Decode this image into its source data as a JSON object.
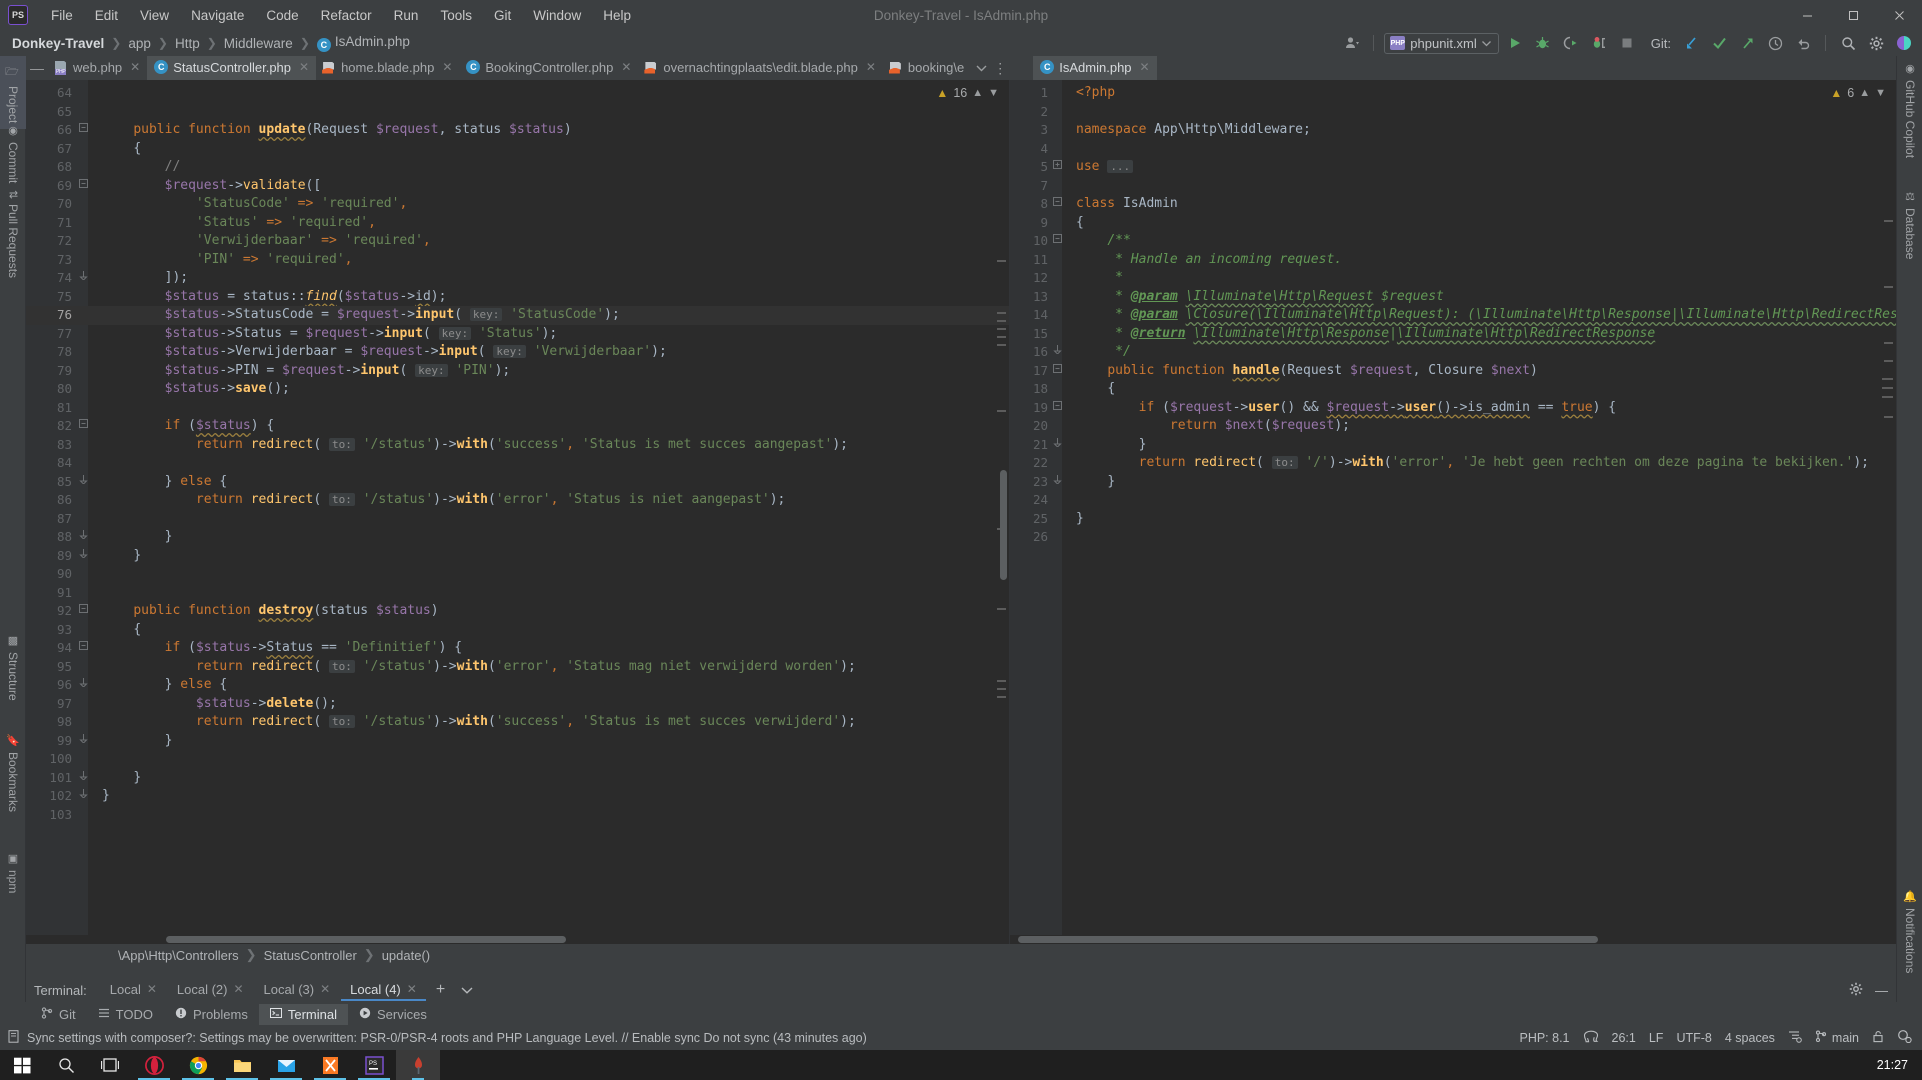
{
  "window": {
    "title": "Donkey-Travel - IsAdmin.php",
    "logo": "PS",
    "controls": [
      "minimize",
      "maximize",
      "close"
    ]
  },
  "menu": {
    "items": [
      "File",
      "Edit",
      "View",
      "Navigate",
      "Code",
      "Refactor",
      "Run",
      "Tools",
      "Git",
      "Window",
      "Help"
    ]
  },
  "breadcrumb": {
    "items": [
      "Donkey-Travel",
      "app",
      "Http",
      "Middleware",
      "IsAdmin.php"
    ],
    "file_icon_letter": "C"
  },
  "toolbar": {
    "run_config": "phpunit.xml",
    "git_label": "Git:",
    "icons": [
      "person-icon",
      "run-icon",
      "debug-icon",
      "coverage-icon",
      "profile-icon",
      "stop-icon",
      "update-project-icon",
      "commit-icon",
      "push-icon",
      "history-icon",
      "rollback-icon",
      "search-everywhere-icon",
      "settings-icon",
      "ai-assistant-icon"
    ]
  },
  "left_stripe": {
    "items": [
      "Project",
      "Commit",
      "Pull Requests",
      "Structure",
      "Bookmarks",
      "npm"
    ],
    "selected": "Project"
  },
  "right_stripe": {
    "items": [
      "GitHub Copilot",
      "Database",
      "Notifications"
    ]
  },
  "tabs": {
    "left_group": [
      {
        "label": "web.php",
        "icon": "php-file-icon",
        "active": false
      },
      {
        "label": "StatusController.php",
        "icon": "php-class-icon",
        "active": true
      },
      {
        "label": "home.blade.php",
        "icon": "blade-file-icon",
        "active": false
      },
      {
        "label": "BookingController.php",
        "icon": "php-class-icon",
        "active": false
      },
      {
        "label": "overnachtingplaats\\edit.blade.php",
        "icon": "blade-file-icon",
        "active": false
      },
      {
        "label": "booking\\e",
        "icon": "blade-file-icon",
        "active": false
      }
    ],
    "right_group": [
      {
        "label": "IsAdmin.php",
        "icon": "php-class-icon",
        "active": true
      }
    ]
  },
  "left_editor": {
    "inspection_count": "16",
    "inspection_icon": "warning-triangle-icon",
    "first_line": 64,
    "current_line": 76,
    "lines": [
      {
        "n": 64,
        "fold": "",
        "html": ""
      },
      {
        "n": 65,
        "fold": "",
        "html": ""
      },
      {
        "n": 66,
        "fold": "minus",
        "html": "    <span class=\"k\">public function</span> <span class=\"fnb sqy\">update</span><span class=\"pl\">(</span><span class=\"cls\">Request</span> <span class=\"var\">$request</span><span class=\"pl\">,</span> <span class=\"cls\">status</span> <span class=\"var\">$status</span><span class=\"pl\">)</span>"
      },
      {
        "n": 67,
        "fold": "",
        "html": "    <span class=\"pl\">{</span>"
      },
      {
        "n": 68,
        "fold": "",
        "html": "        <span class=\"cmt\">//</span>"
      },
      {
        "n": 69,
        "fold": "minus",
        "html": "        <span class=\"var\">$request</span><span class=\"pl\">-&gt;</span><span class=\"fn\">validate</span><span class=\"pl\">([</span>"
      },
      {
        "n": 70,
        "fold": "",
        "html": "            <span class=\"str\">'StatusCode'</span> <span class=\"k\">=&gt;</span> <span class=\"str\">'required'</span><span class=\"k\">,</span>"
      },
      {
        "n": 71,
        "fold": "",
        "html": "            <span class=\"str\">'Status'</span> <span class=\"k\">=&gt;</span> <span class=\"str\">'required'</span><span class=\"k\">,</span>"
      },
      {
        "n": 72,
        "fold": "",
        "html": "            <span class=\"str\">'Verwijderbaar'</span> <span class=\"k\">=&gt;</span> <span class=\"str\">'required'</span><span class=\"k\">,</span>"
      },
      {
        "n": 73,
        "fold": "",
        "html": "            <span class=\"str\">'PIN'</span> <span class=\"k\">=&gt;</span> <span class=\"str\">'required'</span><span class=\"k\">,</span>"
      },
      {
        "n": 74,
        "fold": "end",
        "html": "        <span class=\"pl\">]);</span>"
      },
      {
        "n": 75,
        "fold": "",
        "html": "        <span class=\"var\">$status</span> <span class=\"pl\">=</span> <span class=\"cls\">status</span><span class=\"pl\">::</span><span class=\"fn ita sqy\">find</span><span class=\"pl\">(</span><span class=\"var\">$status</span><span class=\"pl\">-&gt;</span><span class=\"pl sqy\">id</span><span class=\"pl\">);</span>"
      },
      {
        "n": 76,
        "fold": "",
        "cur": true,
        "html": "        <span class=\"var\">$status</span><span class=\"pl\">-&gt;StatusCode =</span> <span class=\"var\">$request</span><span class=\"pl\">-&gt;</span><span class=\"fnb\">input</span><span class=\"pl\">(</span> <span class=\"hint\">key:</span> <span class=\"str\">'StatusCode'</span><span class=\"pl\">);</span>"
      },
      {
        "n": 77,
        "fold": "",
        "html": "        <span class=\"var\">$status</span><span class=\"pl\">-&gt;Status =</span> <span class=\"var\">$request</span><span class=\"pl\">-&gt;</span><span class=\"fnb\">input</span><span class=\"pl\">(</span> <span class=\"hint\">key:</span> <span class=\"str\">'Status'</span><span class=\"pl\">);</span>"
      },
      {
        "n": 78,
        "fold": "",
        "html": "        <span class=\"var\">$status</span><span class=\"pl\">-&gt;Verwijderbaar =</span> <span class=\"var\">$request</span><span class=\"pl\">-&gt;</span><span class=\"fnb\">input</span><span class=\"pl\">(</span> <span class=\"hint\">key:</span> <span class=\"str\">'Verwijderbaar'</span><span class=\"pl\">);</span>"
      },
      {
        "n": 79,
        "fold": "",
        "html": "        <span class=\"var\">$status</span><span class=\"pl\">-&gt;PIN =</span> <span class=\"var\">$request</span><span class=\"pl\">-&gt;</span><span class=\"fnb\">input</span><span class=\"pl\">(</span> <span class=\"hint\">key:</span> <span class=\"str\">'PIN'</span><span class=\"pl\">);</span>"
      },
      {
        "n": 80,
        "fold": "",
        "html": "        <span class=\"var\">$status</span><span class=\"pl\">-&gt;</span><span class=\"fnb\">save</span><span class=\"pl\">();</span>"
      },
      {
        "n": 81,
        "fold": "",
        "html": ""
      },
      {
        "n": 82,
        "fold": "minus",
        "html": "        <span class=\"k\">if</span> <span class=\"pl\">(</span><span class=\"var sqy\">$status</span><span class=\"pl\">) {</span>"
      },
      {
        "n": 83,
        "fold": "",
        "html": "            <span class=\"k\">return</span> <span class=\"fn\">redirect</span><span class=\"pl\">(</span> <span class=\"hint\">to:</span> <span class=\"str\">'/status'</span><span class=\"pl\">)-&gt;</span><span class=\"fnb\">with</span><span class=\"pl\">(</span><span class=\"str\">'success'</span><span class=\"k\">,</span> <span class=\"str\">'Status is met succes aangepast'</span><span class=\"pl\">);</span>"
      },
      {
        "n": 84,
        "fold": "",
        "html": ""
      },
      {
        "n": 85,
        "fold": "end",
        "html": "        <span class=\"pl\">}</span> <span class=\"k\">else</span> <span class=\"pl\">{</span>"
      },
      {
        "n": 86,
        "fold": "",
        "html": "            <span class=\"k\">return</span> <span class=\"fn\">redirect</span><span class=\"pl\">(</span> <span class=\"hint\">to:</span> <span class=\"str\">'/status'</span><span class=\"pl\">)-&gt;</span><span class=\"fnb\">with</span><span class=\"pl\">(</span><span class=\"str\">'error'</span><span class=\"k\">,</span> <span class=\"str\">'Status is niet aangepast'</span><span class=\"pl\">);</span>"
      },
      {
        "n": 87,
        "fold": "",
        "html": ""
      },
      {
        "n": 88,
        "fold": "end",
        "html": "        <span class=\"pl\">}</span>"
      },
      {
        "n": 89,
        "fold": "end",
        "html": "    <span class=\"pl\">}</span>"
      },
      {
        "n": 90,
        "fold": "",
        "html": ""
      },
      {
        "n": 91,
        "fold": "",
        "html": ""
      },
      {
        "n": 92,
        "fold": "minus",
        "html": "    <span class=\"k\">public function</span> <span class=\"fnb sqy\">destroy</span><span class=\"pl\">(</span><span class=\"cls\">status</span> <span class=\"var\">$status</span><span class=\"pl\">)</span>"
      },
      {
        "n": 93,
        "fold": "",
        "html": "    <span class=\"pl\">{</span>"
      },
      {
        "n": 94,
        "fold": "minus",
        "html": "        <span class=\"k\">if</span> <span class=\"pl\">(</span><span class=\"var\">$status</span><span class=\"pl\">-&gt;</span><span class=\"pl sqy\">Status</span> <span class=\"pl\">==</span> <span class=\"str\">'Definitief'</span><span class=\"pl\">) {</span>"
      },
      {
        "n": 95,
        "fold": "",
        "html": "            <span class=\"k\">return</span> <span class=\"fn\">redirect</span><span class=\"pl\">(</span> <span class=\"hint\">to:</span> <span class=\"str\">'/status'</span><span class=\"pl\">)-&gt;</span><span class=\"fnb\">with</span><span class=\"pl\">(</span><span class=\"str\">'error'</span><span class=\"k\">,</span> <span class=\"str\">'Status mag niet verwijderd worden'</span><span class=\"pl\">);</span>"
      },
      {
        "n": 96,
        "fold": "end",
        "html": "        <span class=\"pl\">}</span> <span class=\"k\">else</span> <span class=\"pl\">{</span>"
      },
      {
        "n": 97,
        "fold": "",
        "html": "            <span class=\"var\">$status</span><span class=\"pl\">-&gt;</span><span class=\"fnb\">delete</span><span class=\"pl\">();</span>"
      },
      {
        "n": 98,
        "fold": "",
        "html": "            <span class=\"k\">return</span> <span class=\"fn\">redirect</span><span class=\"pl\">(</span> <span class=\"hint\">to:</span> <span class=\"str\">'/status'</span><span class=\"pl\">)-&gt;</span><span class=\"fnb\">with</span><span class=\"pl\">(</span><span class=\"str\">'success'</span><span class=\"k\">,</span> <span class=\"str\">'Status is met succes verwijderd'</span><span class=\"pl\">);</span>"
      },
      {
        "n": 99,
        "fold": "end",
        "html": "        <span class=\"pl\">}</span>"
      },
      {
        "n": 100,
        "fold": "",
        "html": ""
      },
      {
        "n": 101,
        "fold": "end",
        "html": "    <span class=\"pl\">}</span>"
      },
      {
        "n": 102,
        "fold": "end",
        "html": "<span class=\"pl\">}</span>"
      },
      {
        "n": 103,
        "fold": "",
        "html": ""
      }
    ]
  },
  "right_editor": {
    "inspection_count": "6",
    "inspection_icon": "warning-triangle-icon",
    "lines": [
      {
        "n": 1,
        "fold": "",
        "html": "<span class=\"k\">&lt;?php</span>"
      },
      {
        "n": 2,
        "fold": "",
        "html": ""
      },
      {
        "n": 3,
        "fold": "",
        "html": "<span class=\"k\">namespace</span> <span class=\"pl\">App\\Http\\Middleware;</span>"
      },
      {
        "n": 4,
        "fold": "",
        "html": ""
      },
      {
        "n": 5,
        "fold": "plus",
        "html": "<span class=\"k\">use</span> <span class=\"hint\">...</span>"
      },
      {
        "n": 7,
        "fold": "",
        "html": ""
      },
      {
        "n": 8,
        "fold": "minus",
        "html": "<span class=\"k\">class</span> <span class=\"cls\">IsAdmin</span>"
      },
      {
        "n": 9,
        "fold": "",
        "html": "<span class=\"pl\">{</span>"
      },
      {
        "n": 10,
        "fold": "minus",
        "html": "    <span class=\"doc\">/**</span>"
      },
      {
        "n": 11,
        "fold": "",
        "html": "     <span class=\"doc\">* Handle an incoming request.</span>"
      },
      {
        "n": 12,
        "fold": "",
        "html": "     <span class=\"doc\">*</span>"
      },
      {
        "n": 13,
        "fold": "",
        "html": "     <span class=\"doc\">* </span><span class=\"doctag\">@param</span> <span class=\"doc sq\">\\Illuminate\\Http\\Request</span> <span class=\"doc\">$request</span>"
      },
      {
        "n": 14,
        "fold": "",
        "html": "     <span class=\"doc\">* </span><span class=\"doctag\">@param</span> <span class=\"doc sq\">\\Closure(\\Illuminate\\Http\\Request): (\\Illuminate\\Http\\Response|\\Illuminate\\Http\\RedirectResp</span>"
      },
      {
        "n": 15,
        "fold": "",
        "html": "     <span class=\"doc\">* </span><span class=\"doctag\">@return</span> <span class=\"doc sq\">\\Illuminate\\Http\\Response</span><span class=\"doc\">|</span><span class=\"doc sq\">\\Illuminate\\Http\\RedirectResponse</span>"
      },
      {
        "n": 16,
        "fold": "end",
        "html": "     <span class=\"doc\">*/</span>"
      },
      {
        "n": 17,
        "fold": "minus",
        "html": "    <span class=\"k\">public function</span> <span class=\"fnb sqy\">handle</span><span class=\"pl\">(</span><span class=\"cls\">Request</span> <span class=\"var\">$request</span><span class=\"pl\">,</span> <span class=\"cls\">Closure</span> <span class=\"var\">$next</span><span class=\"pl\">)</span>"
      },
      {
        "n": 18,
        "fold": "",
        "html": "    <span class=\"pl\">{</span>"
      },
      {
        "n": 19,
        "fold": "minus",
        "html": "        <span class=\"k\">if</span> <span class=\"pl\">(</span><span class=\"var\">$request</span><span class=\"pl\">-&gt;</span><span class=\"fnb\">user</span><span class=\"pl\">() &amp;&amp; </span><span class=\"var sqy\">$request</span><span class=\"pl sqy\">-&gt;</span><span class=\"fnb sqy\">user</span><span class=\"pl sqy\">()-&gt;is_admin</span> <span class=\"pl\">==</span> <span class=\"k sqy\">true</span><span class=\"pl\">) {</span>"
      },
      {
        "n": 20,
        "fold": "",
        "html": "            <span class=\"k\">return</span> <span class=\"var\">$next</span><span class=\"pl\">(</span><span class=\"var\">$request</span><span class=\"pl\">);</span>"
      },
      {
        "n": 21,
        "fold": "end",
        "html": "        <span class=\"pl\">}</span>"
      },
      {
        "n": 22,
        "fold": "",
        "html": "        <span class=\"k\">return</span> <span class=\"fn\">redirect</span><span class=\"pl\">(</span> <span class=\"hint\">to:</span> <span class=\"str\">'/'</span><span class=\"pl\">)-&gt;</span><span class=\"fnb\">with</span><span class=\"pl\">(</span><span class=\"str\">'error'</span><span class=\"k\">,</span> <span class=\"str\">'Je hebt geen rechten om deze pagina te bekijken.'</span><span class=\"pl\">);</span>"
      },
      {
        "n": 23,
        "fold": "end",
        "html": "    <span class=\"pl\">}</span>"
      },
      {
        "n": 24,
        "fold": "",
        "html": ""
      },
      {
        "n": 25,
        "fold": "",
        "html": "<span class=\"pl\">}</span>"
      },
      {
        "n": 26,
        "fold": "",
        "html": ""
      }
    ]
  },
  "editor_breadcrumb": {
    "items": [
      "\\App\\Http\\Controllers",
      "StatusController",
      "update()"
    ]
  },
  "terminal": {
    "label": "Terminal:",
    "tabs": [
      "Local",
      "Local (2)",
      "Local (3)",
      "Local (4)"
    ],
    "active": "Local (4)",
    "add_label": "+",
    "chevron": "chevron-down-icon"
  },
  "bottom_tabs": [
    {
      "label": "Git",
      "icon": "git-branch-icon",
      "active": false
    },
    {
      "label": "TODO",
      "icon": "todo-list-icon",
      "active": false
    },
    {
      "label": "Problems",
      "icon": "problems-icon",
      "active": false
    },
    {
      "label": "Terminal",
      "icon": "terminal-icon",
      "active": true
    },
    {
      "label": "Services",
      "icon": "services-play-icon",
      "active": false
    }
  ],
  "statusbar": {
    "message": "Sync settings with composer?: Settings may be overwritten: PSR-0/PSR-4 roots and PHP Language Level. // Enable sync   Do not sync (43 minutes ago)",
    "php_version": "PHP: 8.1",
    "caret": "26:1",
    "line_sep": "LF",
    "encoding": "UTF-8",
    "indent": "4 spaces",
    "branch": "main",
    "icons": [
      "elephant-icon",
      "indent-settings-icon",
      "git-branch-icon",
      "lock-icon",
      "inspections-icon"
    ]
  },
  "taskbar": {
    "items": [
      "start-icon",
      "search-icon",
      "task-view-icon",
      "opera-icon",
      "chrome-icon",
      "file-explorer-icon",
      "mail-icon",
      "xampp-icon",
      "phpstorm-icon",
      "terminal-icon"
    ],
    "clock": "21:27"
  },
  "colors": {
    "accent": "#4a88c7",
    "editor_bg": "#2b2b2b",
    "chrome_bg": "#3c3f41",
    "keyword": "#cc7832",
    "string": "#6a8759",
    "variable": "#9876aa",
    "function": "#ffc66d",
    "doc": "#629755"
  }
}
